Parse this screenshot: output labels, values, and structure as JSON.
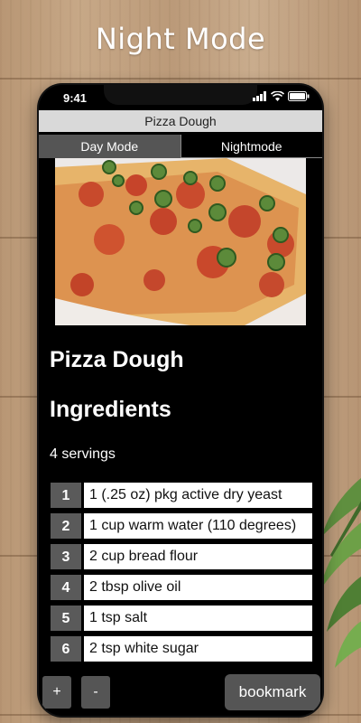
{
  "headline": "Night Mode",
  "status": {
    "time": "9:41"
  },
  "app": {
    "title": "Pizza Dough",
    "tabs": [
      {
        "label": "Day Mode"
      },
      {
        "label": "Nightmode"
      }
    ]
  },
  "recipe": {
    "name": "Pizza Dough",
    "section_title": "Ingredients",
    "servings": "4 servings",
    "ingredients": [
      {
        "num": "1",
        "text": "1 (.25 oz) pkg active dry yeast"
      },
      {
        "num": "2",
        "text": "1 cup warm water (110 degrees)"
      },
      {
        "num": "3",
        "text": "2 cup bread flour"
      },
      {
        "num": "4",
        "text": "2 tbsp olive oil"
      },
      {
        "num": "5",
        "text": "1 tsp salt"
      },
      {
        "num": "6",
        "text": "2 tsp white sugar"
      }
    ]
  },
  "controls": {
    "plus": "+",
    "minus": "-",
    "bookmark": "bookmark"
  },
  "colors": {
    "screen_bg": "#000000",
    "tab_active": "#555555",
    "title_bar": "#d9d9d9"
  }
}
